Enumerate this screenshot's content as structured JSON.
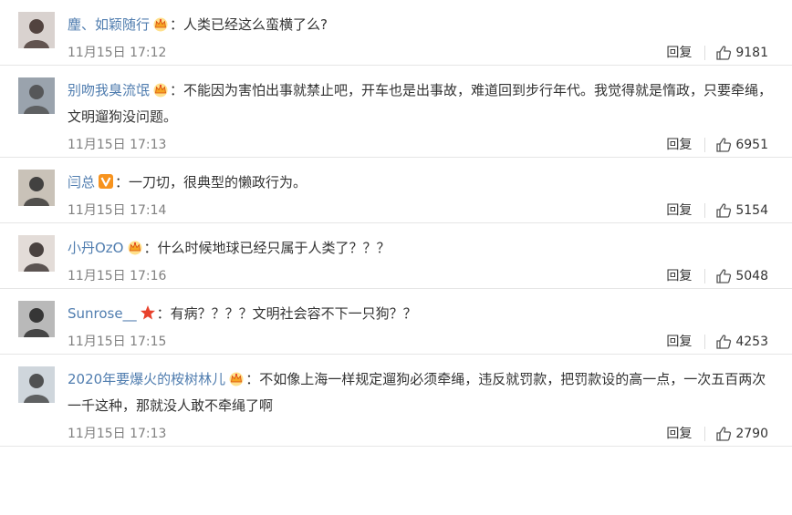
{
  "comments": [
    {
      "user": "麈、如颖随行",
      "badge": "crown",
      "text": "人类已经这么蛮横了么?",
      "time": "11月15日 17:12",
      "reply": "回复",
      "likes": "9181",
      "avatar_colors": [
        "#d9d2cf",
        "#3a2a26"
      ]
    },
    {
      "user": "别吻我臭流氓",
      "badge": "crown",
      "text": "不能因为害怕出事就禁止吧，开车也是出事故，难道回到步行年代。我觉得就是惰政，只要牵绳，文明遛狗没问题。",
      "time": "11月15日 17:13",
      "reply": "回复",
      "likes": "6951",
      "avatar_colors": [
        "#9aa3ad",
        "#4a4a4a"
      ]
    },
    {
      "user": "闫总",
      "badge": "v",
      "text": "一刀切，很典型的懒政行为。",
      "time": "11月15日 17:14",
      "reply": "回复",
      "likes": "5154",
      "avatar_colors": [
        "#c9c2b8",
        "#2a2a2a"
      ]
    },
    {
      "user": "小丹OzO",
      "badge": "crown",
      "text": "什么时候地球已经只属于人类了？？？",
      "time": "11月15日 17:16",
      "reply": "回复",
      "likes": "5048",
      "avatar_colors": [
        "#e3dcd8",
        "#2e2624"
      ]
    },
    {
      "user": "Sunrose__",
      "badge": "star",
      "text": "有病？？？？文明社会容不下一只狗？？",
      "time": "11月15日 17:15",
      "reply": "回复",
      "likes": "4253",
      "avatar_colors": [
        "#b9b9b9",
        "#1f1f1f"
      ]
    },
    {
      "user": "2020年要爆火的桉树林儿",
      "badge": "crown",
      "text": "不如像上海一样规定遛狗必须牵绳，违反就罚款，把罚款设的高一点，一次五百两次一千这种，那就没人敢不牵绳了啊",
      "time": "11月15日 17:13",
      "reply": "回复",
      "likes": "2790",
      "avatar_colors": [
        "#cfd6dc",
        "#3a3a3a"
      ]
    }
  ],
  "colors": {
    "username": "#507daf",
    "text": "#333333",
    "time": "#808080",
    "divider": "#e6e6e6",
    "crown": "#f5a623",
    "v_badge": "#f7931e",
    "star": "#e8412c"
  },
  "icons": {
    "like": "thumbs-up-icon",
    "crown": "crown-badge-icon",
    "v": "v-badge-icon",
    "star": "star-badge-icon"
  }
}
